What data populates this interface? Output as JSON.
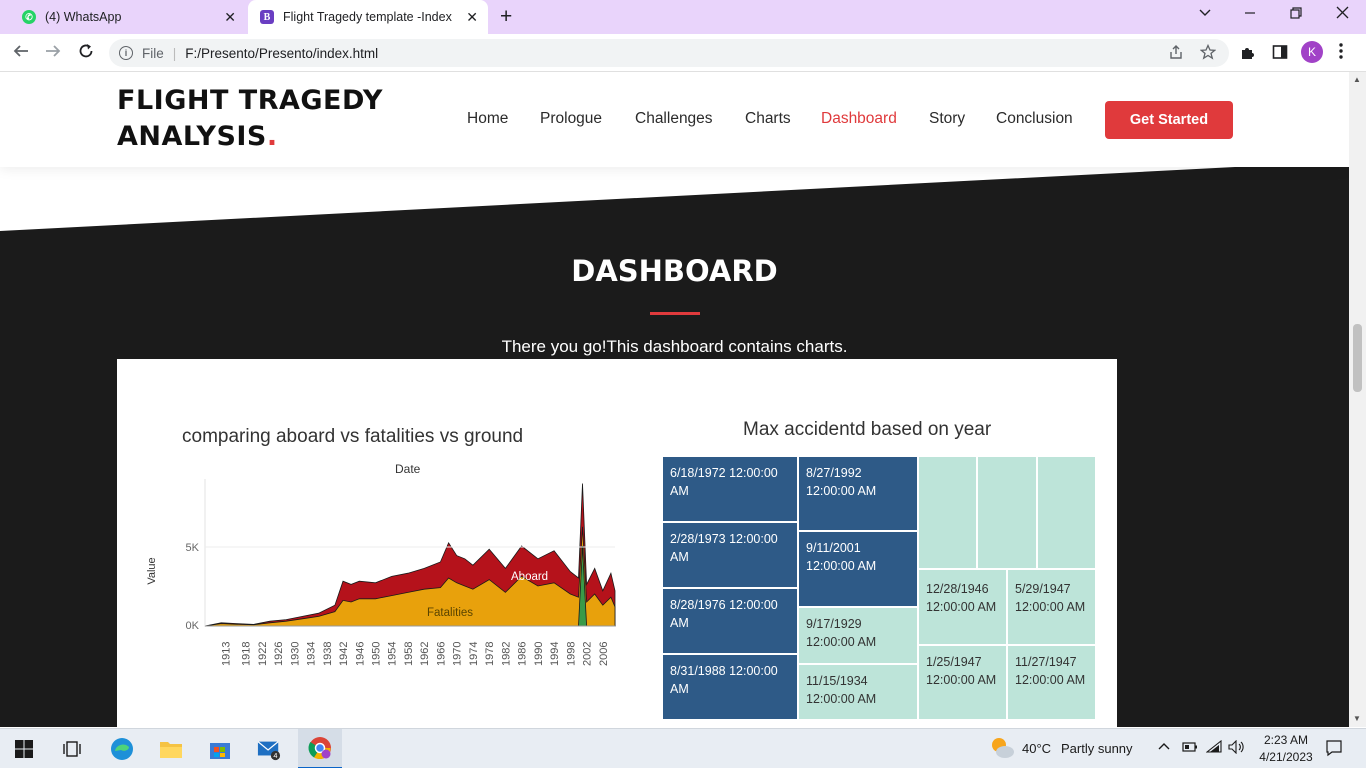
{
  "browser": {
    "tabs": [
      {
        "title": "(4) WhatsApp",
        "icon": "whatsapp-icon",
        "active": false
      },
      {
        "title": "Flight Tragedy template -Index",
        "icon": "bootstrap-icon",
        "active": true
      }
    ],
    "file_label": "File",
    "url": "F:/Presento/Presento/index.html",
    "profile_initial": "K"
  },
  "site": {
    "logo_line1": "FLIGHT TRAGEDY",
    "logo_line2": "ANALYSIS",
    "logo_dot": ".",
    "nav": [
      "Home",
      "Prologue",
      "Challenges",
      "Charts",
      "Dashboard",
      "Story",
      "Conclusion"
    ],
    "active_nav": "Dashboard",
    "cta": "Get Started",
    "accent": "#e03a3c"
  },
  "section": {
    "title": "DASHBOARD",
    "subtitle": "There you go!This dashboard contains charts."
  },
  "area_chart": {
    "title": "comparing aboard vs fatalities vs ground",
    "x_title": "Date",
    "y_title": "Value",
    "y_ticks": [
      "5K",
      "0K"
    ],
    "x_ticks": [
      "1913",
      "1918",
      "1922",
      "1926",
      "1930",
      "1934",
      "1938",
      "1942",
      "1946",
      "1950",
      "1954",
      "1958",
      "1962",
      "1966",
      "1970",
      "1974",
      "1978",
      "1982",
      "1986",
      "1990",
      "1994",
      "1998",
      "2002",
      "2006"
    ],
    "label_aboard": "Aboard",
    "label_fatalities": "Fatalities",
    "colors": {
      "aboard": "#b5121b",
      "fatalities": "#e8a10c",
      "ground": "#3a9a48"
    }
  },
  "chart_data": {
    "type": "area",
    "x": [
      1908,
      1912,
      1916,
      1920,
      1924,
      1928,
      1932,
      1936,
      1940,
      1942,
      1944,
      1946,
      1950,
      1954,
      1958,
      1962,
      1966,
      1968,
      1970,
      1972,
      1974,
      1978,
      1982,
      1986,
      1990,
      1994,
      1998,
      2000,
      2001,
      2002,
      2004,
      2006,
      2008,
      2009
    ],
    "series": [
      {
        "name": "Aboard",
        "values": [
          0,
          200,
          150,
          100,
          300,
          400,
          600,
          800,
          1300,
          2800,
          2600,
          2800,
          2700,
          3100,
          3300,
          3600,
          4000,
          5200,
          4400,
          4200,
          3800,
          4800,
          3600,
          5000,
          4200,
          4700,
          3400,
          3000,
          8900,
          2600,
          3600,
          2200,
          3300,
          2200
        ]
      },
      {
        "name": "Fatalities",
        "values": [
          0,
          150,
          100,
          80,
          200,
          300,
          450,
          600,
          900,
          1600,
          1500,
          1700,
          1700,
          1900,
          2100,
          2300,
          2400,
          3000,
          2700,
          2500,
          2300,
          2900,
          2100,
          3100,
          2500,
          2700,
          2000,
          1800,
          6200,
          1500,
          2000,
          1300,
          1800,
          1200
        ]
      },
      {
        "name": "Ground",
        "values": [
          0,
          0,
          0,
          0,
          0,
          0,
          0,
          0,
          0,
          0,
          0,
          0,
          0,
          0,
          0,
          0,
          0,
          0,
          0,
          0,
          0,
          0,
          0,
          0,
          0,
          0,
          0,
          0,
          5000,
          0,
          0,
          0,
          0,
          0
        ]
      }
    ],
    "ylim": [
      0,
      9000
    ]
  },
  "treemap": {
    "title": "Max accidentd based on year",
    "dark_color": "#2e5a87",
    "light_color": "#bde4d9",
    "cells": [
      "6/18/1972 12:00:00 AM",
      "2/28/1973 12:00:00 AM",
      "8/28/1976 12:00:00 AM",
      "8/31/1988 12:00:00 AM",
      "8/27/1992 12:00:00 AM",
      "9/11/2001 12:00:00 AM",
      "9/17/1929 12:00:00 AM",
      "11/15/1934 12:00:00 AM",
      "12/28/1946 12:00:00 AM",
      "5/29/1947 12:00:00 AM",
      "1/25/1947 12:00:00 AM",
      "11/27/1947 12:00:00 AM"
    ]
  },
  "taskbar": {
    "weather_temp": "40°C",
    "weather_desc": "Partly sunny",
    "time": "2:23 AM",
    "date": "4/21/2023",
    "mail_badge": "4"
  }
}
